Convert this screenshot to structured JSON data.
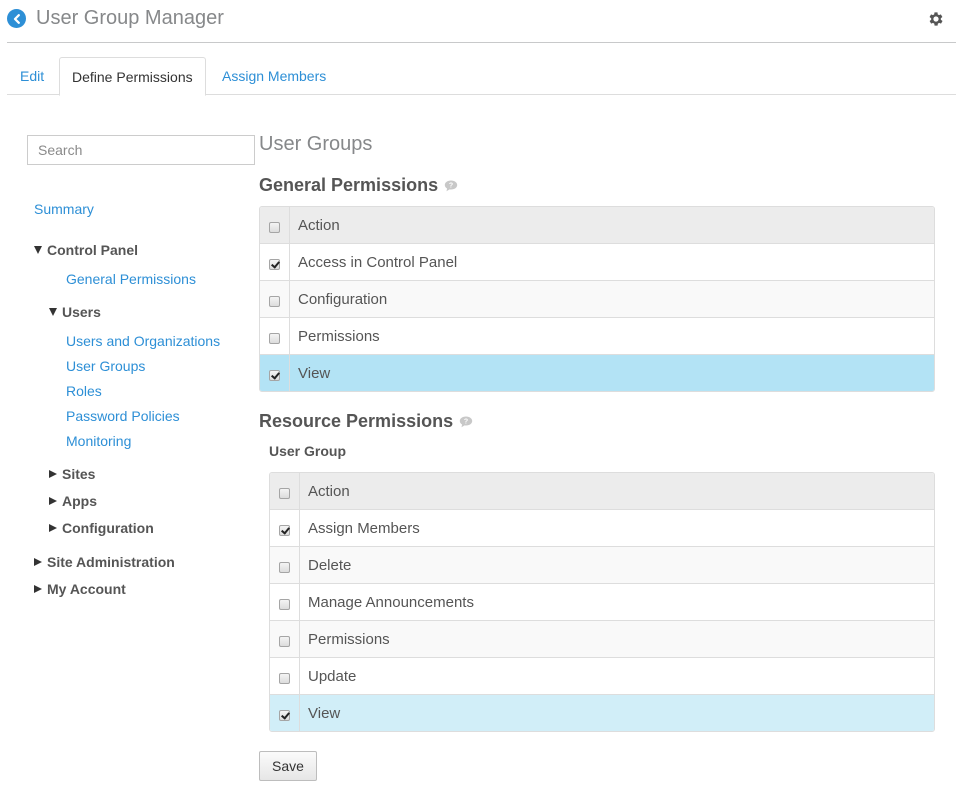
{
  "header": {
    "title": "User Group Manager",
    "back_icon": "chevron-left-icon",
    "settings_icon": "gear-icon"
  },
  "tabs": [
    {
      "label": "Edit",
      "active": false
    },
    {
      "label": "Define Permissions",
      "active": true
    },
    {
      "label": "Assign Members",
      "active": false
    }
  ],
  "sidebar": {
    "search_placeholder": "Search",
    "summary": "Summary",
    "control_panel": "Control Panel",
    "general_permissions": "General Permissions",
    "users": "Users",
    "users_items": [
      "Users and Organizations",
      "User Groups",
      "Roles",
      "Password Policies",
      "Monitoring"
    ],
    "sites": "Sites",
    "apps": "Apps",
    "configuration": "Configuration",
    "site_administration": "Site Administration",
    "my_account": "My Account"
  },
  "main": {
    "title": "User Groups",
    "general": {
      "heading": "General Permissions",
      "header": "Action",
      "rows": [
        {
          "label": "Access in Control Panel",
          "checked": true
        },
        {
          "label": "Configuration",
          "checked": false
        },
        {
          "label": "Permissions",
          "checked": false
        },
        {
          "label": "View",
          "checked": true
        }
      ]
    },
    "resource": {
      "heading": "Resource Permissions",
      "subheading": "User Group",
      "header": "Action",
      "rows": [
        {
          "label": "Assign Members",
          "checked": true
        },
        {
          "label": "Delete",
          "checked": false
        },
        {
          "label": "Manage Announcements",
          "checked": false
        },
        {
          "label": "Permissions",
          "checked": false
        },
        {
          "label": "Update",
          "checked": false
        },
        {
          "label": "View",
          "checked": true
        }
      ]
    },
    "save_label": "Save"
  },
  "colors": {
    "link": "#2d8fd6",
    "selected_row": "#b3e3f5",
    "selected_row_light": "#d1eef8"
  }
}
